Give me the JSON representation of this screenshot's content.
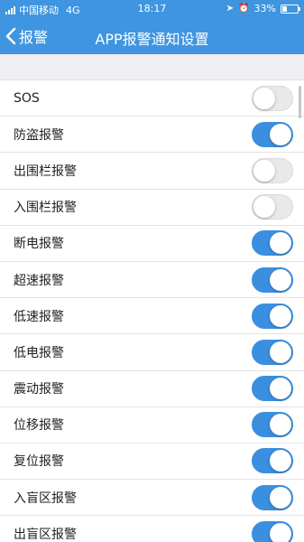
{
  "status_bar": {
    "carrier": "中国移动",
    "network": "4G",
    "time": "18:17",
    "battery_pct": "33%",
    "battery_level": 0.33,
    "icons": [
      "location-icon",
      "alarm-icon",
      "battery-icon"
    ]
  },
  "nav": {
    "back_label": "报警",
    "title": "APP报警通知设置"
  },
  "colors": {
    "accent": "#3f95e0",
    "toggle_on": "#3b8fe0",
    "toggle_off": "#e9e9ea"
  },
  "items": [
    {
      "label": "SOS",
      "on": false
    },
    {
      "label": "防盗报警",
      "on": true
    },
    {
      "label": "出围栏报警",
      "on": false
    },
    {
      "label": "入围栏报警",
      "on": false
    },
    {
      "label": "断电报警",
      "on": true
    },
    {
      "label": "超速报警",
      "on": true
    },
    {
      "label": "低速报警",
      "on": true
    },
    {
      "label": "低电报警",
      "on": true
    },
    {
      "label": "震动报警",
      "on": true
    },
    {
      "label": "位移报警",
      "on": true
    },
    {
      "label": "复位报警",
      "on": true
    },
    {
      "label": "入盲区报警",
      "on": true
    },
    {
      "label": "出盲区报警",
      "on": true
    }
  ]
}
